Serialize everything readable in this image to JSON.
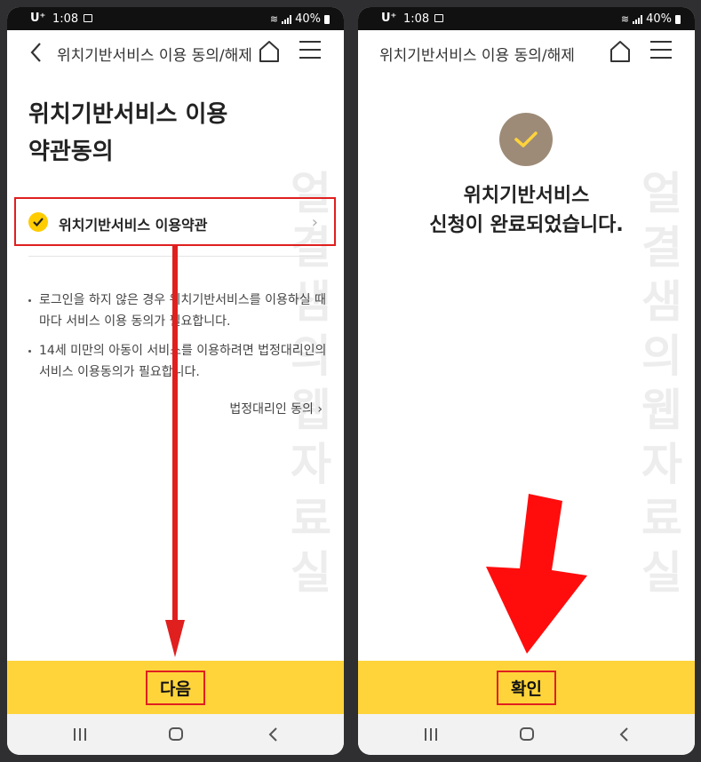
{
  "status_bar": {
    "carrier": "U⁺",
    "time": "1:08",
    "battery": "40%"
  },
  "left_screen": {
    "header_title": "위치기반서비스 이용 동의/해제",
    "title_line1": "위치기반서비스 이용",
    "title_line2": "약관동의",
    "terms_item": "위치기반서비스 이용약관",
    "notes": [
      "로그인을 하지 않은 경우 위치기반서비스를 이용하실 때마다 서비스 이용 동의가 필요합니다.",
      "14세 미만의 아동이 서비스를 이용하려면 법정대리인의 서비스 이용동의가 필요합니다."
    ],
    "guardian_link": "법정대리인 동의",
    "next_button": "다음"
  },
  "right_screen": {
    "header_title": "위치기반서비스 이용 동의/해제",
    "message_line1": "위치기반서비스",
    "message_line2": "신청이 완료되었습니다.",
    "confirm_button": "확인"
  },
  "watermark": "얼결샘의웹자료실",
  "colors": {
    "accent_yellow": "#ffd43b",
    "highlight_red": "#e01f1f",
    "check_brown": "#9d8b78"
  }
}
